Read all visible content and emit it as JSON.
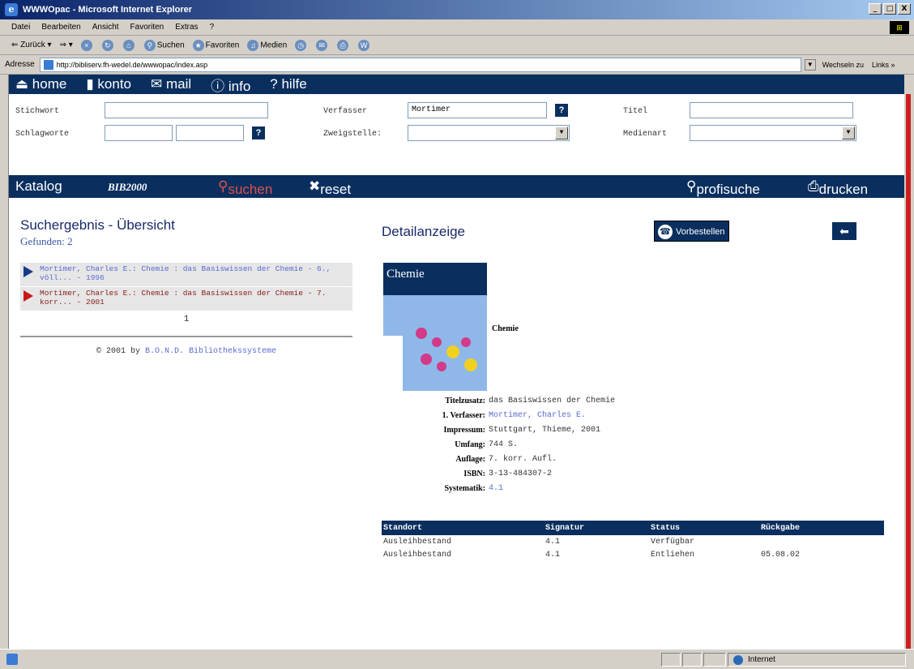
{
  "window": {
    "title": "WWWOpac - Microsoft Internet Explorer",
    "min": "_",
    "max": "□",
    "close": "X"
  },
  "menu": [
    "Datei",
    "Bearbeiten",
    "Ansicht",
    "Favoriten",
    "Extras",
    "?"
  ],
  "toolbar": {
    "back": "Zurück",
    "search": "Suchen",
    "favorites": "Favoriten",
    "media": "Medien"
  },
  "address": {
    "label": "Adresse",
    "url": "http://bibliserv.fh-wedel.de/wwwopac/index.asp",
    "go": "Wechseln zu",
    "links": "Links »"
  },
  "nav": [
    "home",
    "konto",
    "mail",
    "info",
    "? hilfe"
  ],
  "form": {
    "stichwort_label": "Stichwort",
    "schlagworte_label": "Schlagworte",
    "verfasser_label": "Verfasser",
    "verfasser_value": "Mortimer",
    "zweigstelle_label": "Zweigstelle:",
    "titel_label": "Titel",
    "medienart_label": "Medienart",
    "help": "?"
  },
  "katbar": {
    "katalog": "Katalog",
    "bib": "BIB2000",
    "suchen": "suchen",
    "reset": "reset",
    "profisuche": "profisuche",
    "drucken": "drucken"
  },
  "results": {
    "title": "Suchergebnis - Übersicht",
    "found_label": "Gefunden:",
    "found_count": "2",
    "items": [
      {
        "text": "Mortimer, Charles E.: Chemie : das Basiswissen der Chemie - 6., völl... - 1996"
      },
      {
        "text": "Mortimer, Charles E.: Chemie : das Basiswissen der Chemie - 7. korr... - 2001"
      }
    ],
    "pager": "1",
    "copyright": "© 2001 by",
    "copyright_link": "B.O.N.D. Bibliothekssysteme"
  },
  "detail": {
    "title": "Detailanzeige",
    "vorbestellen": "Vorbestellen",
    "back": "⬅",
    "cover_title": "Chemie",
    "cover_caption": "Chemie",
    "fields": [
      {
        "key": "Titelzusatz:",
        "value": "das Basiswissen der Chemie",
        "link": false
      },
      {
        "key": "1. Verfasser:",
        "value": "Mortimer, Charles E.",
        "link": true
      },
      {
        "key": "Impressum:",
        "value": "Stuttgart, Thieme, 2001",
        "link": false
      },
      {
        "key": "Umfang:",
        "value": "744 S.",
        "link": false
      },
      {
        "key": "Auflage:",
        "value": "7. korr. Aufl.",
        "link": false
      },
      {
        "key": "ISBN:",
        "value": "3-13-484307-2",
        "link": false
      },
      {
        "key": "Systematik:",
        "value": "4.1",
        "link": true
      }
    ],
    "table": {
      "headers": [
        "Standort",
        "Signatur",
        "Status",
        "Rückgabe"
      ],
      "rows": [
        [
          "Ausleihbestand",
          "4.1",
          "Verfügbar",
          ""
        ],
        [
          "Ausleihbestand",
          "4.1",
          "Entliehen",
          "05.08.02"
        ]
      ]
    }
  },
  "statusbar": {
    "zone": "Internet"
  }
}
